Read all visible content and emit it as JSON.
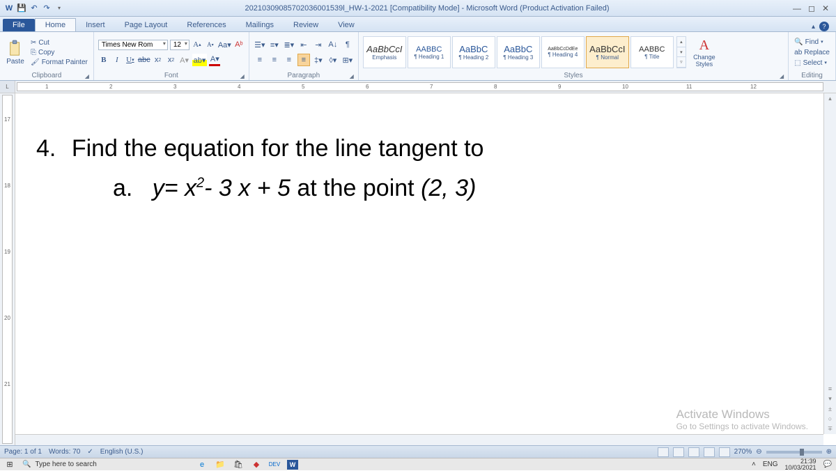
{
  "titlebar": {
    "title": "20210309085702036001539l_HW-1-2021 [Compatibility Mode] - Microsoft Word (Product Activation Failed)"
  },
  "tabs": [
    "File",
    "Home",
    "Insert",
    "Page Layout",
    "References",
    "Mailings",
    "Review",
    "View"
  ],
  "clipboard": {
    "label": "Clipboard",
    "paste": "Paste",
    "cut": "Cut",
    "copy": "Copy",
    "fmt": "Format Painter"
  },
  "font": {
    "label": "Font",
    "family": "Times New Rom",
    "size": "12"
  },
  "paragraph": {
    "label": "Paragraph"
  },
  "styles": {
    "label": "Styles",
    "items": [
      {
        "prev": "AaBbCcI",
        "name": "Emphasis",
        "em": true
      },
      {
        "prev": "AABBC",
        "name": "¶ Heading 1",
        "h": true,
        "small": true
      },
      {
        "prev": "AaBbC",
        "name": "¶ Heading 2",
        "h": true
      },
      {
        "prev": "AaBbC",
        "name": "¶ Heading 3",
        "h": true
      },
      {
        "prev": "AaBbCcDdEe",
        "name": "¶ Heading 4",
        "tiny": true
      },
      {
        "prev": "AaBbCcI",
        "name": "¶ Normal",
        "sel": true
      },
      {
        "prev": "AABBC",
        "name": "¶ Title",
        "small": true
      }
    ],
    "change": "Change Styles"
  },
  "editing": {
    "label": "Editing",
    "find": "Find",
    "replace": "Replace",
    "select": "Select"
  },
  "ruler": {
    "marks": [
      1,
      2,
      3,
      4,
      5,
      6,
      7,
      8,
      9,
      10,
      11,
      12
    ],
    "vmarks": [
      17,
      18,
      19,
      20,
      21
    ]
  },
  "doc": {
    "qnum": "4.",
    "qtext": "Find the equation for the line tangent to",
    "subletter": "a.",
    "eq_y": "y= x",
    "eq_rest": "- 3 x + 5 ",
    "eq_at": "at the point ",
    "eq_pt": "(2, 3)"
  },
  "watermark": {
    "l1": "Activate Windows",
    "l2": "Go to Settings to activate Windows."
  },
  "status": {
    "page": "Page: 1 of 1",
    "words": "Words: 70",
    "lang": "English (U.S.)",
    "zoom": "270%"
  },
  "taskbar": {
    "search": "Type here to search",
    "lang": "ENG",
    "time": "21:39",
    "date": "10/03/2021"
  }
}
